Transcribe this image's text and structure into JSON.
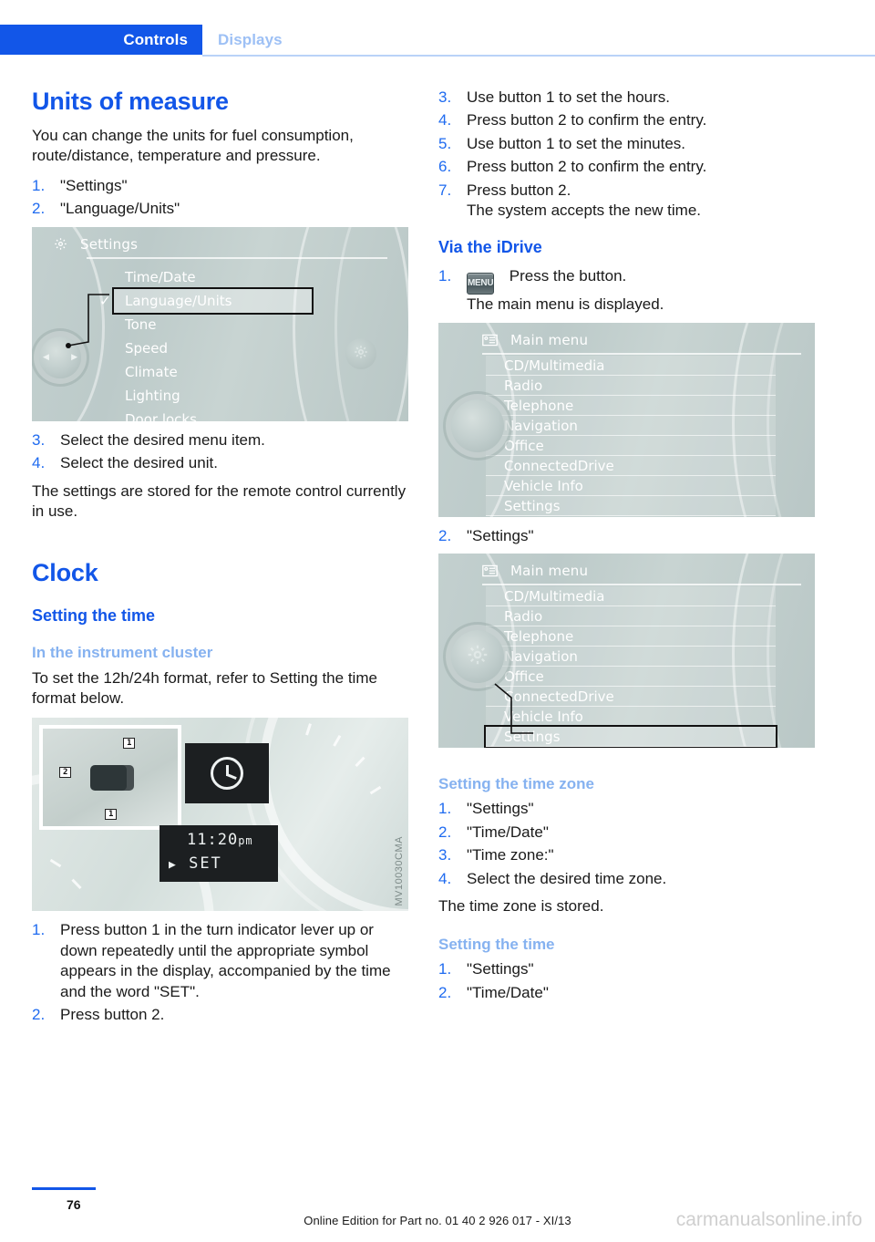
{
  "header": {
    "tab_active": "Controls",
    "tab_inactive": "Displays"
  },
  "left": {
    "title": "Units of measure",
    "intro": "You can change the units for fuel consumption, route/distance, temperature and pressure.",
    "steps_a": [
      {
        "num": "1.",
        "text": "\"Settings\""
      },
      {
        "num": "2.",
        "text": "\"Language/Units\""
      }
    ],
    "settings_screen": {
      "title": "Settings",
      "icon": "gear-icon",
      "items": [
        {
          "label": "Time/Date",
          "selected": false,
          "check": false
        },
        {
          "label": "Language/Units",
          "selected": true,
          "check": true
        },
        {
          "label": "Tone",
          "selected": false,
          "check": false
        },
        {
          "label": "Speed",
          "selected": false,
          "check": false
        },
        {
          "label": "Climate",
          "selected": false,
          "check": false
        },
        {
          "label": "Lighting",
          "selected": false,
          "check": false
        },
        {
          "label": "Door locks",
          "selected": false,
          "check": false
        }
      ]
    },
    "steps_b": [
      {
        "num": "3.",
        "text": "Select the desired menu item."
      },
      {
        "num": "4.",
        "text": "Select the desired unit."
      }
    ],
    "after_text": "The settings are stored for the remote control currently in use.",
    "clock_title": "Clock",
    "setting_time_heading": "Setting the time",
    "cluster_heading": "In the instrument cluster",
    "cluster_text": "To set the 12h/24h format, refer to Setting the time format below.",
    "cluster_image": {
      "time": "11:20",
      "meridiem": "pm",
      "set_label": "SET",
      "callout_1": "1",
      "callout_1b": "1",
      "callout_2": "2",
      "photo_code": "MV10030CMA"
    },
    "steps_c": [
      {
        "num": "1.",
        "text": "Press button 1 in the turn indicator lever up or down repeatedly until the appropriate symbol appears in the display, accompanied by the time and the word \"SET\"."
      },
      {
        "num": "2.",
        "text": "Press button 2."
      }
    ]
  },
  "right": {
    "steps_d": [
      {
        "num": "3.",
        "text": "Use button 1 to set the hours."
      },
      {
        "num": "4.",
        "text": "Press button 2 to confirm the entry."
      },
      {
        "num": "5.",
        "text": "Use button 1 to set the minutes."
      },
      {
        "num": "6.",
        "text": "Press button 2 to confirm the entry."
      },
      {
        "num": "7.",
        "text": "Press button 2."
      }
    ],
    "step7_note": "The system accepts the new time.",
    "idrive_heading": "Via the iDrive",
    "idrive_step1": {
      "num": "1.",
      "button_label": "MENU",
      "text": "Press the button."
    },
    "idrive_step1_note": "The main menu is displayed.",
    "main_menu_1": {
      "title": "Main menu",
      "icon": "list-icon",
      "items": [
        {
          "label": "CD/Multimedia",
          "selected": false
        },
        {
          "label": "Radio",
          "selected": false
        },
        {
          "label": "Telephone",
          "selected": false
        },
        {
          "label": "Navigation",
          "selected": false
        },
        {
          "label": "Office",
          "selected": false
        },
        {
          "label": "ConnectedDrive",
          "selected": false
        },
        {
          "label": "Vehicle Info",
          "selected": false
        },
        {
          "label": "Settings",
          "selected": false
        }
      ]
    },
    "step_settings": {
      "num": "2.",
      "text": "\"Settings\""
    },
    "main_menu_2": {
      "title": "Main menu",
      "icon": "list-icon",
      "items": [
        {
          "label": "CD/Multimedia",
          "selected": false
        },
        {
          "label": "Radio",
          "selected": false
        },
        {
          "label": "Telephone",
          "selected": false
        },
        {
          "label": "Navigation",
          "selected": false
        },
        {
          "label": "Office",
          "selected": false
        },
        {
          "label": "ConnectedDrive",
          "selected": false
        },
        {
          "label": "Vehicle Info",
          "selected": false
        },
        {
          "label": "Settings",
          "selected": true
        }
      ]
    },
    "timezone_heading": "Setting the time zone",
    "steps_tz": [
      {
        "num": "1.",
        "text": "\"Settings\""
      },
      {
        "num": "2.",
        "text": "\"Time/Date\""
      },
      {
        "num": "3.",
        "text": "\"Time zone:\""
      },
      {
        "num": "4.",
        "text": "Select the desired time zone."
      }
    ],
    "tz_stored": "The time zone is stored.",
    "settime_heading": "Setting the time",
    "steps_st": [
      {
        "num": "1.",
        "text": "\"Settings\""
      },
      {
        "num": "2.",
        "text": "\"Time/Date\""
      }
    ]
  },
  "footer": {
    "page_number": "76",
    "edition": "Online Edition for Part no. 01 40 2 926 017 - XI/13",
    "watermark": "carmanualsonline.info"
  },
  "colors": {
    "accent_blue": "#1256e8",
    "light_blue": "#86b2f0",
    "tab_inactive": "#9dc0f5",
    "screen_bg": "#bfcccb"
  }
}
